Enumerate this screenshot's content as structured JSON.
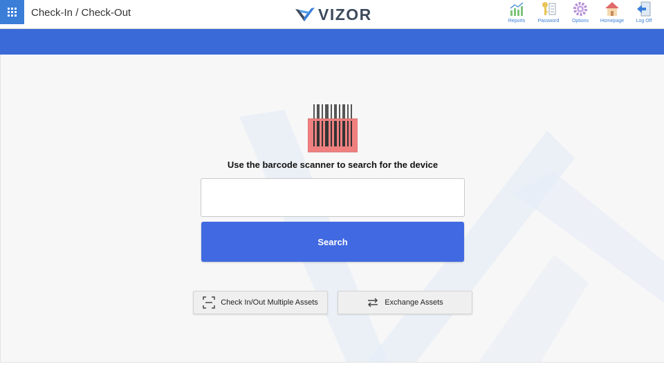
{
  "header": {
    "title": "Check-In / Check-Out",
    "logo_text": "VIZOR",
    "menu_icon": "grid-icon",
    "nav": [
      {
        "label": "Reports",
        "icon": "reports-chart-icon"
      },
      {
        "label": "Password",
        "icon": "password-key-icon"
      },
      {
        "label": "Options",
        "icon": "options-gear-icon"
      },
      {
        "label": "Homepage",
        "icon": "home-icon"
      },
      {
        "label": "Log Off",
        "icon": "log-off-icon"
      }
    ]
  },
  "main": {
    "barcode_icon": "barcode-scanner-icon",
    "instruction": "Use the barcode scanner to search for the device",
    "search_input": {
      "value": "",
      "placeholder": ""
    },
    "search_button": "Search",
    "multi_button": "Check In/Out Multiple Assets",
    "exchange_button": "Exchange Assets"
  },
  "colors": {
    "accent_blue": "#3a6ad7",
    "search_button": "#4169e1",
    "menu_button": "#3a7ed8",
    "barcode_red": "#f08080"
  }
}
